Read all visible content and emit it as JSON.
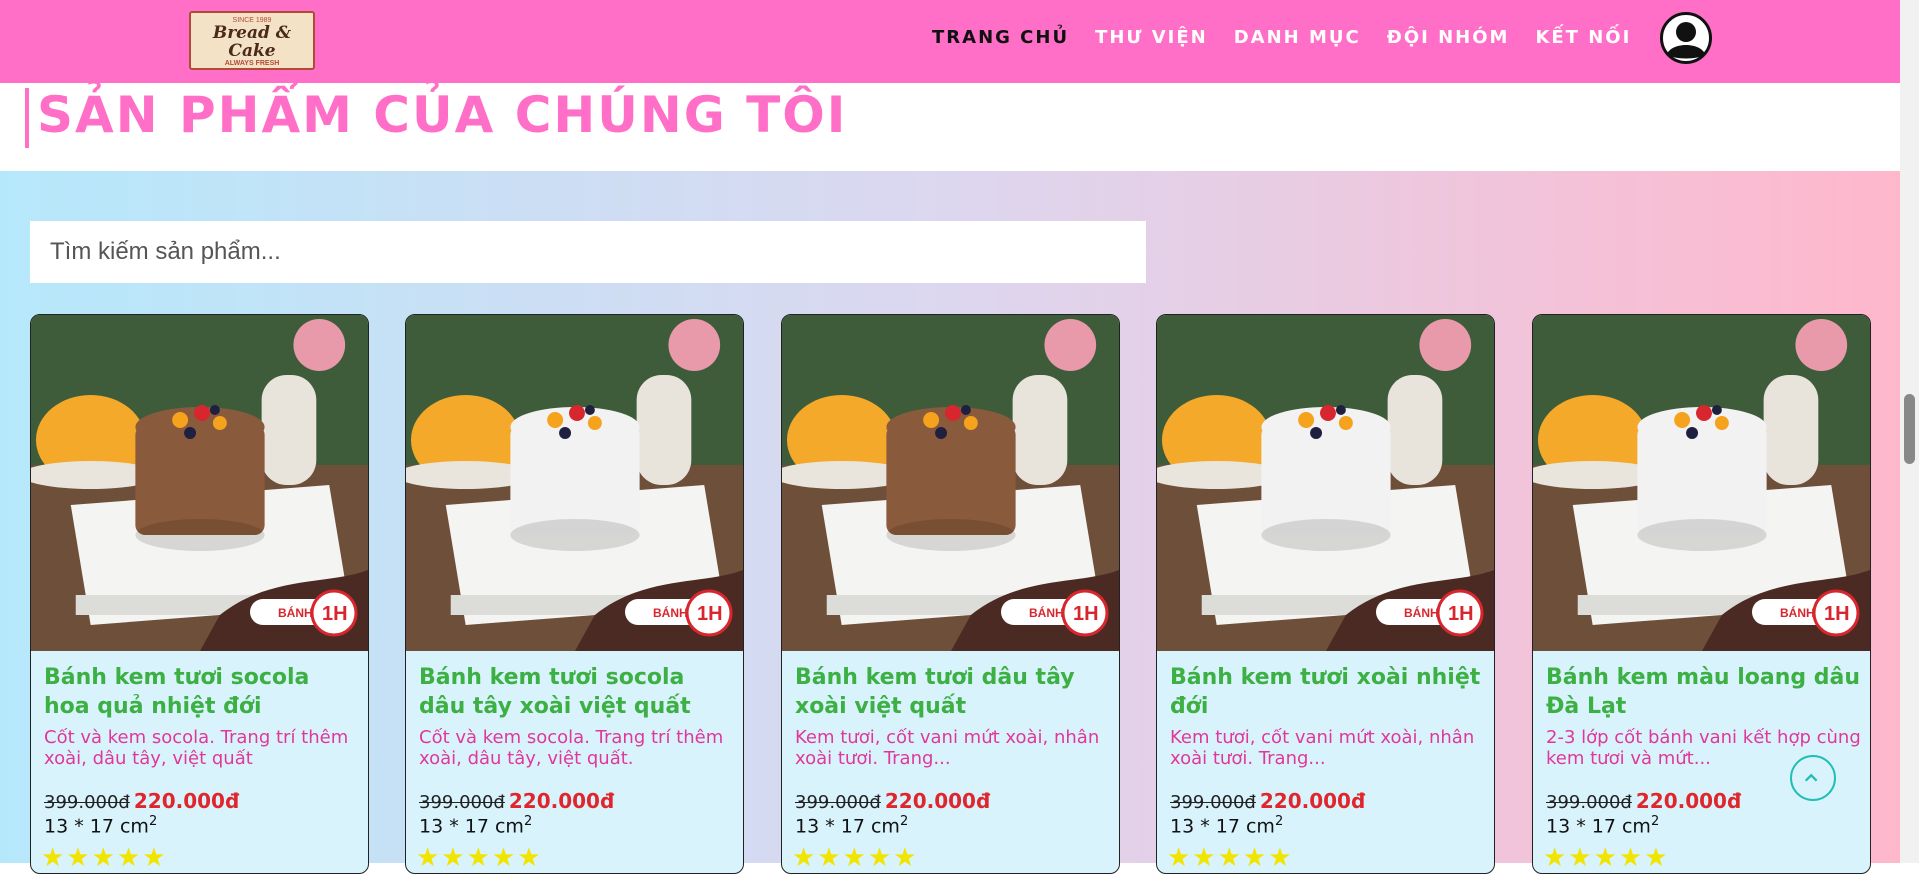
{
  "header": {
    "logo": {
      "since": "SINCE 1989",
      "brand": "Bread & Cake",
      "tagline": "ALWAYS FRESH"
    },
    "nav": [
      "TRANG CHỦ",
      "THƯ VIỆN",
      "DANH MỤC",
      "ĐỘI NHÓM",
      "KẾT NỐI"
    ],
    "active_nav": "TRANG CHỦ"
  },
  "section_title": "SẢN PHẨM CỦA CHÚNG TÔI",
  "search": {
    "placeholder": "Tìm kiếm sản phẩm...",
    "value": ""
  },
  "badge_text": "BÁNH",
  "badge_time": "1H",
  "products": [
    {
      "name": "Bánh kem tươi socola hoa quả nhiệt đới",
      "desc": "Cốt và kem socola. Trang trí thêm xoài, dâu tây, việt quất",
      "old_price": "399.000đ",
      "price": "220.000đ",
      "size": "13 * 17 cm",
      "size_sup": "2",
      "rating": 5,
      "cake_color": "#8a5a3c"
    },
    {
      "name": "Bánh kem tươi socola dâu tây xoài việt quất",
      "desc": "Cốt và kem socola. Trang trí thêm xoài, dâu tây, việt quất.",
      "old_price": "399.000đ",
      "price": "220.000đ",
      "size": "13 * 17 cm",
      "size_sup": "2",
      "rating": 5,
      "cake_color": "#f2f2f2"
    },
    {
      "name": "Bánh kem tươi dâu tây xoài việt quất",
      "desc": "Kem tươi, cốt vani mứt xoài, nhân xoài tươi. Trang...",
      "old_price": "399.000đ",
      "price": "220.000đ",
      "size": "13 * 17 cm",
      "size_sup": "2",
      "rating": 5,
      "cake_color": "#8a5a3c"
    },
    {
      "name": "Bánh kem tươi xoài nhiệt đới",
      "desc": "Kem tươi, cốt vani mứt xoài, nhân xoài tươi. Trang...",
      "old_price": "399.000đ",
      "price": "220.000đ",
      "size": "13 * 17 cm",
      "size_sup": "2",
      "rating": 5,
      "cake_color": "#f2f2f2"
    },
    {
      "name": "Bánh kem màu loang dâu Đà Lạt",
      "desc": "2-3 lớp cốt bánh vani kết hợp cùng kem tươi và mứt...",
      "old_price": "399.000đ",
      "price": "220.000đ",
      "size": "13 * 17 cm",
      "size_sup": "2",
      "rating": 5,
      "cake_color": "#f2f2f2"
    }
  ],
  "colors": {
    "nav": "#ff6ec7",
    "accent": "#ff6ec7",
    "name": "#3cb043",
    "desc": "#e0389a",
    "price": "#e0262d",
    "star": "#f1e400"
  }
}
